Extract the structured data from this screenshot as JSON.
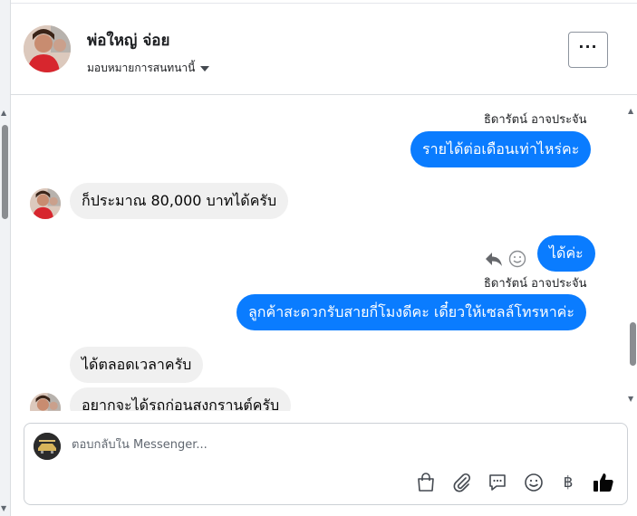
{
  "conversation": {
    "contact_name": "พ่อใหญ่ จ่อย",
    "assign_label": "มอบหมายการสนทนานี้",
    "more_label": "···"
  },
  "messages": [
    {
      "sender": "ธิดารัตน์ อาจประจัน",
      "text": "รายได้ต่อเดือนเท่าไหร่คะ"
    },
    {
      "text": "ก็ประมาณ 80,000 บาทได้ครับ"
    },
    {
      "text": "ได้ค่ะ"
    },
    {
      "sender": "ธิดารัตน์ อาจประจัน",
      "text": "ลูกค้าสะดวกรับสายกี่โมงดีคะ เดี๋ยวให้เซลล์โทรหาค่ะ"
    },
    {
      "text": "ได้ตลอดเวลาครับ"
    },
    {
      "text": "อยากจะได้รถก่อนสงกรานต์ครับ"
    }
  ],
  "composer": {
    "placeholder": "ตอบกลับใน Messenger...",
    "currency_symbol": "฿"
  },
  "colors": {
    "outgoing_bubble": "#0a7cff",
    "incoming_bubble": "#f0f0f0",
    "like_icon": "#050505"
  }
}
